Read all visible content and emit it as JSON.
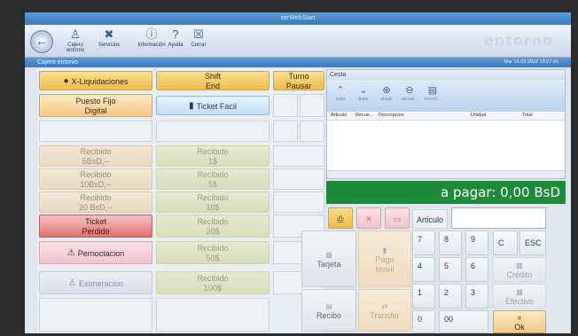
{
  "window": {
    "title": "iterWebStart"
  },
  "ribbon": {
    "back_icon": "arrow-left-icon",
    "items": [
      {
        "label": "Cajero entorno",
        "icon": "user-icon"
      },
      {
        "label": "Servicios",
        "icon": "tools-icon"
      },
      {
        "label": "Información",
        "icon": "help-icon"
      },
      {
        "label": "Ayuda",
        "icon": "help-icon"
      },
      {
        "label": "Cerrar",
        "icon": "close-icon"
      }
    ],
    "logo": "entorno"
  },
  "subbar": {
    "title": "Cajero entorvo",
    "datetime": "Mar 15.03.2022 13:27:41"
  },
  "buttons": {
    "x_liquidaciones": "X-Liquidaciones",
    "shift_end": [
      "Shift",
      "End"
    ],
    "turno_pausar": [
      "Turno",
      "Pausar"
    ],
    "puesto_fijo": [
      "Puesto Fijo",
      "Digital"
    ],
    "ticket_facil": "Ticket Facil",
    "recibido_bsd": [
      [
        "Recibido",
        "5BsD,--"
      ],
      [
        "Recibido",
        "10BsD,--"
      ],
      [
        "Recibido",
        "20 BsD,--"
      ]
    ],
    "recibido_usd": [
      [
        "Recibido",
        "1$"
      ],
      [
        "Recibido",
        "5$"
      ],
      [
        "Recibido",
        "10$"
      ],
      [
        "Recibido",
        "20$"
      ],
      [
        "Recibido",
        "50$"
      ],
      [
        "Recibido",
        "100$"
      ]
    ],
    "ticket_perdido": [
      "Ticket",
      "Perdido"
    ],
    "pernoctacion": "Pernoctacion",
    "exoneracion": "Exoneracion",
    "tarjeta": "Tarjeta",
    "pago_movil": [
      "Pago",
      "Movil"
    ],
    "recibo": "Recibo",
    "transfer": "Transfer"
  },
  "cesta": {
    "title": "Cesta",
    "tools": [
      "subir",
      "bajar",
      "añadir",
      "record...",
      "record..."
    ],
    "columns": [
      "Articulo",
      "Recue...",
      "Descripcion",
      "Unidad",
      "Total"
    ]
  },
  "payment": {
    "label": "a pagar:",
    "amount": "0,00 BsD"
  },
  "articulo": {
    "label": "Articulo",
    "value": ""
  },
  "keypad": {
    "keys": [
      "7",
      "8",
      "9",
      "C",
      "ESC",
      "4",
      "5",
      "6",
      "1",
      "2",
      "3",
      "0",
      "00"
    ],
    "credito": "Crédito",
    "efectivo": "Efectivo",
    "ok": "Ok"
  },
  "colors": {
    "pay_bar": "#1d8a3a",
    "titlebar": "#3b78c0",
    "ticket_perdido": "#e07070"
  }
}
